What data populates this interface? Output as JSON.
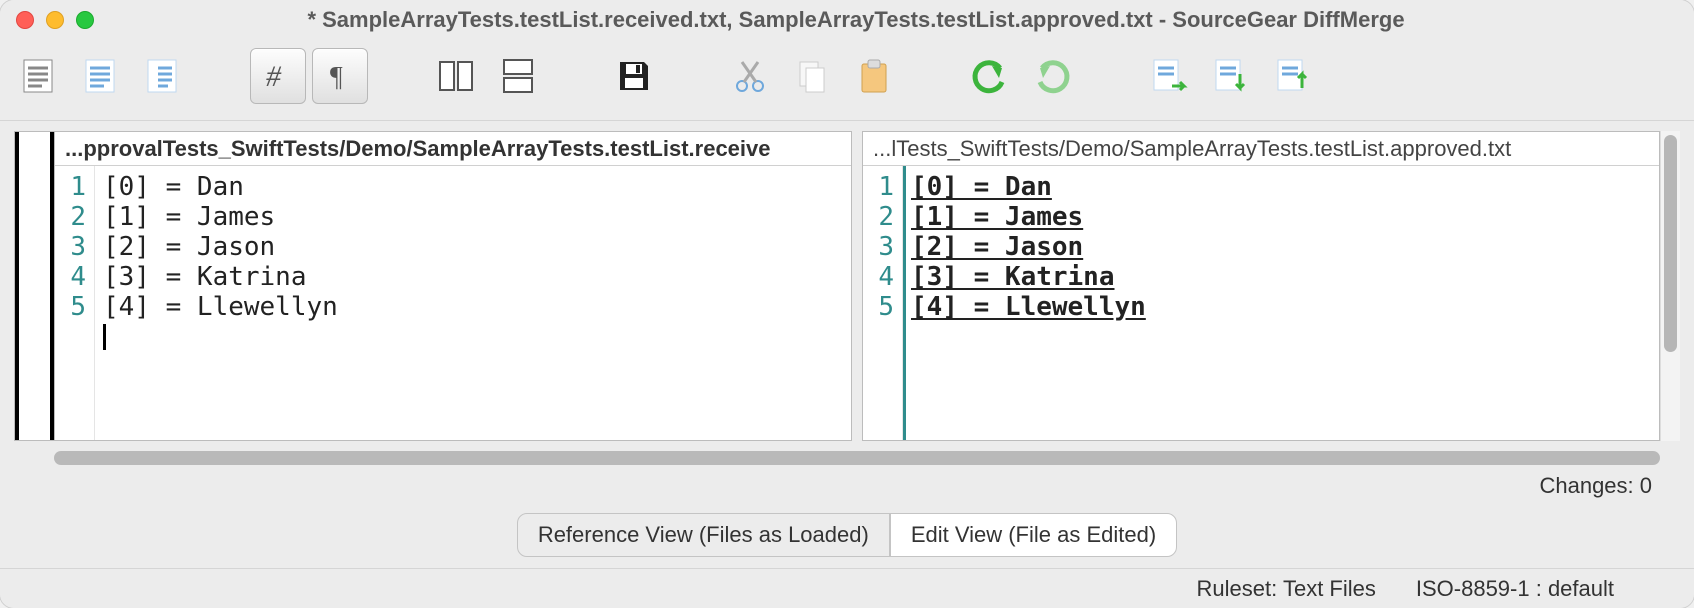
{
  "titlebar": {
    "title": "* SampleArrayTests.testList.received.txt, SampleArrayTests.testList.approved.txt - SourceGear DiffMerge"
  },
  "panes": {
    "left": {
      "path": "...pprovalTests_SwiftTests/Demo/SampleArrayTests.testList.receive",
      "lines": [
        "[0] = Dan",
        "[1] = James",
        "[2] = Jason",
        "[3] = Katrina",
        "[4] = Llewellyn"
      ]
    },
    "right": {
      "path": "...lTests_SwiftTests/Demo/SampleArrayTests.testList.approved.txt",
      "lines": [
        "[0] = Dan",
        "[1] = James",
        "[2] = Jason",
        "[3] = Katrina",
        "[4] = Llewellyn"
      ]
    }
  },
  "status": {
    "changes": "Changes: 0"
  },
  "tabs": {
    "reference": "Reference View (Files as Loaded)",
    "edit": "Edit View (File as Edited)"
  },
  "footer": {
    "ruleset": "Ruleset: Text Files",
    "encoding": "ISO-8859-1 : default"
  },
  "line_numbers": [
    "1",
    "2",
    "3",
    "4",
    "5"
  ]
}
